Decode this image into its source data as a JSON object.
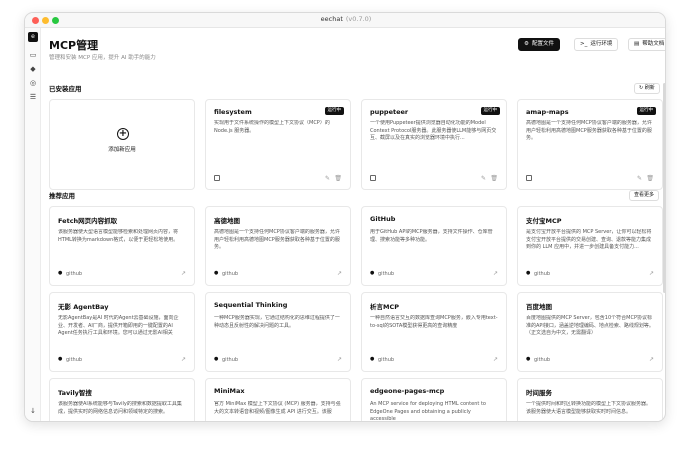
{
  "window": {
    "title": "eechat",
    "version": "(v0.7.0)"
  },
  "sidebar": {
    "logo": "e",
    "icons": [
      "chat-icon",
      "plugin-icon",
      "compass-icon",
      "settings-sliders-icon"
    ],
    "bottom_icon": "arrow-down-icon"
  },
  "header": {
    "title": "MCP管理",
    "subtitle": "管理和安装 MCP 应用，提升 AI 助手的能力",
    "buttons": {
      "config": "配置文件",
      "env": "运行环境",
      "docs": "帮助文档"
    }
  },
  "installed": {
    "heading": "已安装应用",
    "refresh": "刷新",
    "add_label": "添加新应用",
    "items": [
      {
        "name": "filesystem",
        "status": "运行中",
        "desc": "实现用于文件系统操作的模型上下文协议（MCP）的 Node.js 服务器。"
      },
      {
        "name": "puppeteer",
        "status": "运行中",
        "desc": "一个使用Puppeteer提供浏览器自动化功能的Model Context Protocol服务器。此服务器使LLM能够与网页交互、截屏以及在真实的浏览器环境中执行..."
      },
      {
        "name": "amap-maps",
        "status": "运行中",
        "desc": "高德地图是一个支持任何MCP协议客户端的服务器，允许用户轻松利用高德地图MCP服务器获取各种基于位置的服务。"
      }
    ]
  },
  "recommended": {
    "heading": "推荐应用",
    "more": "查看更多",
    "items": [
      {
        "name": "Fetch网页内容抓取",
        "desc": "该服务器使大型语言模型能够检索和处理网页内容，将HTML转换为markdown格式，以便于更轻松地使用。",
        "source": "github",
        "src_icon": "github-icon"
      },
      {
        "name": "高德地图",
        "desc": "高德地图是一个支持任何MCP协议客户端的服务器，允许用户轻松利用高德地图MCP服务器获取各种基于位置的服务。",
        "source": "github",
        "src_icon": "amap-icon"
      },
      {
        "name": "GitHub",
        "desc": "用于GitHub API的MCP服务器，支持文件操作、仓库管理、搜索功能等多种功能。",
        "source": "github",
        "src_icon": "github-icon"
      },
      {
        "name": "支付宝MCP",
        "desc": "是支付宝开放平台提供的 MCP Server，让你可以轻松将支付宝开放平台提供的交易创建、查询、退款等能力集成到你的 LLM 应用中，并进一步创建具备支付能力...",
        "source": "github",
        "src_icon": "alipay-icon"
      },
      {
        "name": "无影 AgentBay",
        "desc": "无影AgentBay是AI 时代的Agent云基础设施，面向企业、开发者、AI厂商，提供开箱即用的一键配置的AI Agent任务执行工具和环境。您可以通过无影AI相关AgentBay...",
        "source": "github",
        "src_icon": "agentbay-icon"
      },
      {
        "name": "Sequential Thinking",
        "desc": "一种MCP服务器实现，它通过结构化的思维过程提供了一种动态且反射性的解决问题的工具。",
        "source": "github",
        "src_icon": "github-icon"
      },
      {
        "name": "析言MCP",
        "desc": "一种自然语言交互的数据库查询MCP服务，嵌入专用text-to-sql的SOTA模型获得更高的查询精度",
        "source": "github",
        "src_icon": "github-icon"
      },
      {
        "name": "百度地图",
        "desc": "百度地图提供的MCP Server，包含10个符合MCP协议标准的API接口，涵盖逆地理编码、地点检索、路线规划等。（正文选自为中文，无需翻译）",
        "source": "github",
        "src_icon": "baidu-map-icon"
      },
      {
        "name": "Tavily智搜",
        "desc": "该服务器使AI系统能够与Tavily的搜索和数据提取工具集成，提供实时的网络信息访问和领域特定的搜索。",
        "source": "github",
        "src_icon": "github-icon"
      },
      {
        "name": "MiniMax",
        "desc": "官方 MiniMax 模型上下文协议 (MCP) 服务器，支持与强大的文本转语音和视频/图像生成 API 进行交互。该服",
        "source": "github",
        "src_icon": "github-icon"
      },
      {
        "name": "edgeone-pages-mcp",
        "desc": "An MCP service for deploying HTML content to EdgeOne Pages and obtaining a publicly accessible",
        "source": "github",
        "src_icon": "github-icon"
      },
      {
        "name": "时间服务",
        "desc": "一个提供时间和时区转换功能的模型上下文协议服务器。该服务器使大语言模型能够获取实时时间信息。",
        "source": "github",
        "src_icon": "github-icon"
      }
    ]
  }
}
